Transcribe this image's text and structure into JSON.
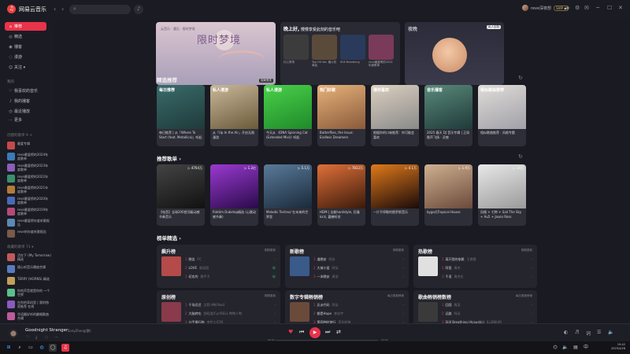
{
  "app": {
    "title": "网易云音乐",
    "logo_glyph": "♫"
  },
  "user": {
    "name": "reve深夜想",
    "vip": "SVIP ◆"
  },
  "sidebar": {
    "nav": [
      {
        "label": "推荐",
        "icon": "home-icon",
        "active": true
      },
      {
        "label": "精选",
        "icon": "compass-icon"
      },
      {
        "label": "播客",
        "icon": "podcast-icon"
      },
      {
        "label": "漫游",
        "icon": "roam-icon"
      },
      {
        "label": "关注 ▾",
        "icon": "follow-icon"
      }
    ],
    "mine_head": "我的",
    "mine": [
      {
        "label": "我喜欢的音乐",
        "icon": "heart-icon"
      },
      {
        "label": "我的播客",
        "icon": "mic-icon"
      },
      {
        "label": "最近播放",
        "icon": "clock-icon"
      },
      {
        "label": "更多",
        "icon": "more-icon"
      }
    ],
    "created_head": "创建的歌单 9  +",
    "created": [
      {
        "label": "最爱专辑",
        "color": "#c44a4a"
      },
      {
        "label": "reve最爱榜的2024年度歌单",
        "color": "#3a7bb8"
      },
      {
        "label": "reve最爱榜的2023年度歌单",
        "color": "#8a5fb5"
      },
      {
        "label": "reve最爱榜的2022年度歌单",
        "color": "#3b8f6e"
      },
      {
        "label": "reve最爱榜的2021年度歌单",
        "color": "#b57a3a"
      },
      {
        "label": "reve最爱榜的2020年度歌单",
        "color": "#4a6ab8"
      },
      {
        "label": "reve最爱榜的2019年度歌单",
        "color": "#b54a7a"
      },
      {
        "label": "reve最爱榜年度听歌报告",
        "color": "#5a8ab5"
      },
      {
        "label": "reve的年度听歌报告",
        "color": "#7a5a4a"
      }
    ],
    "collected_head": "收藏的歌单 71  ▾",
    "collected": [
      {
        "label": "活在下 (My Tomorrow) 精选",
        "color": "#c05a5a"
      },
      {
        "label": "随心听音乐播放合辑",
        "color": "#5a7ac0"
      },
      {
        "label": "TERRY (HORNS) 精选",
        "color": "#c0a05a"
      },
      {
        "label": "你的声音就是你的 一个世界",
        "color": "#5ac08a"
      },
      {
        "label": "在你的耳机里 | 我的独家推荐 在线",
        "color": "#8a5ac0"
      },
      {
        "label": "华语最好听的翻唱歌曲合辑",
        "color": "#c05a9a"
      }
    ]
  },
  "banners": {
    "dream": {
      "title": "限时梦境",
      "subtitle": "云音乐 · 遇见 · 限时梦境",
      "tag": "独家首发"
    },
    "tonight": {
      "title": "晚上好,",
      "subtitle": "慢慢享受此刻的音乐吧",
      "cards": [
        {
          "caption": "灯心秀场",
          "color": "#3c3c3c"
        },
        {
          "caption": "Top Hit Ver. 最火热单曲",
          "color": "#5a4a3a"
        },
        {
          "caption": "Still Breathing",
          "color": "#2a3a5a"
        },
        {
          "caption": "reve最爱榜的2024年度歌单",
          "color": "#7a3a5a"
        }
      ]
    },
    "night": {
      "title": "夜晚",
      "chip": "私人定制"
    }
  },
  "sections": {
    "selected": "精选推荐",
    "playlists": "推荐歌单 ›",
    "charts": "榜单精选 ›"
  },
  "selected_cards": [
    {
      "label": "每日推荐",
      "title": "每日推荐 | 从「Where To Start (feat. Metallica)」听起",
      "grad": "linear-gradient(160deg,#3a6b6b,#1f3a3a)"
    },
    {
      "label": "私人漫游",
      "title": "从「Up In the Air」开启无限漫游",
      "grad": "linear-gradient(160deg,#c9b79a,#6b5a3a)"
    },
    {
      "label": "私人漫游",
      "title": "今天从 《DNA Spinning Cat (Extended Mix)》听起",
      "grad": "linear-gradient(160deg,#4ad14a,#1f8a2a)"
    },
    {
      "label": "热门好歌",
      "title": "Butterflies, the Issue: Endless Dreamers",
      "grad": "linear-gradient(160deg,#e6b27a,#8a5a3a)"
    },
    {
      "label": "猜你喜欢",
      "title": "根据你的口味推荐：你可能会喜欢",
      "grad": "linear-gradient(160deg,#dcd0c0,#8a8a8a)"
    },
    {
      "label": "音乐播客",
      "title": "2025 春天 DJ 音乐专辑 | 正如歌声飞扬 · 灵感",
      "grad": "linear-gradient(160deg,#5a8a7a,#1f3a3a)"
    },
    {
      "label": "相似歌曲推荐",
      "title": "相似歌曲推荐 · 风格专题",
      "grad": "linear-gradient(160deg,#e0dcd8,#a0a0a8)"
    }
  ],
  "playlist_cards": [
    {
      "plays": "▷ 4764万",
      "title": "【电音】全球200首顶级动感节奏音乐",
      "grad": "linear-gradient(160deg,#444,#111)"
    },
    {
      "plays": "▷ 1.2亿",
      "title": "Riddim Dubstep精选 (心跳动感节奏)",
      "grad": "linear-gradient(160deg,#9a3ad1,#2a0a4a)"
    },
    {
      "plays": "▷ 5.1万",
      "title": "Melodic Techno/ 在未来的世界里",
      "grad": "linear-gradient(160deg,#5a7a9a,#1a2a3a)"
    },
    {
      "plays": "▷ 7812万",
      "title": "HDM | 全能hardstyle, 狂燥kick, 震撼听觉",
      "grad": "linear-gradient(160deg,#e0703a,#3a1a0a)"
    },
    {
      "plays": "▷ 4.1万",
      "title": "一片不停歇的俄罗斯音乐",
      "grad": "linear-gradient(160deg,#e07a1a,#1a0a0a)"
    },
    {
      "plays": "▷ 1.9万",
      "title": "kygo式Tropical House",
      "grad": "linear-gradient(160deg,#d0b090,#6a4a3a)"
    },
    {
      "plays": "▷ 10万",
      "title": "风格 + 七种 + Sail The Sky + Au5 + Jason Ross",
      "grad": "linear-gradient(160deg,#e8e8e8,#9a9a9a)"
    }
  ],
  "ranks": [
    {
      "title": "飙升榜",
      "update": "刚刚更新",
      "color": "#b54a4a",
      "rows": [
        {
          "n": "1",
          "song": "晚笑",
          "artist": "FC",
          "trend": "-"
        },
        {
          "n": "2",
          "song": "LOVE",
          "artist": "周深团",
          "trend": "新"
        },
        {
          "n": "3",
          "song": "初恋的",
          "artist": "歌手子",
          "trend": "新"
        }
      ]
    },
    {
      "title": "新歌榜",
      "update": "刚刚更新",
      "color": "#3a5a8a",
      "rows": [
        {
          "n": "1",
          "song": "道晚安",
          "artist": "阿朵",
          "trend": "-"
        },
        {
          "n": "2",
          "song": "大城小爱",
          "artist": "阿朵",
          "trend": "-"
        },
        {
          "n": "3",
          "song": "一米晚安",
          "artist": "周深",
          "trend": "-"
        }
      ]
    },
    {
      "title": "热歌榜",
      "update": "刚刚更新",
      "color": "#e0e0e0",
      "rows": [
        {
          "n": "1",
          "song": "离开我的依赖",
          "artist": "王艳薇",
          "trend": "-"
        },
        {
          "n": "2",
          "song": "阿瓷",
          "artist": "周杰",
          "trend": "-"
        },
        {
          "n": "3",
          "song": "千语",
          "artist": "周杰伦",
          "trend": "-"
        }
      ]
    },
    {
      "title": "原创榜",
      "update": "刚刚更新",
      "color": "#8a3a4a",
      "rows": [
        {
          "n": "1",
          "song": "千场迟迟",
          "artist": "艾莉·A鸭/YoxU",
          "trend": "-"
        },
        {
          "n": "2",
          "song": "大脑转吃",
          "artist": "舒昭游/Cyr/RELL·鸭鸭人鸭",
          "trend": "-"
        },
        {
          "n": "3",
          "song": "分手操行物",
          "artist": "李世人/CFA",
          "trend": "-"
        }
      ]
    },
    {
      "title": "数字专辑畅销榜",
      "update": "每日更新榜单",
      "color": "#6a4a3a",
      "rows": [
        {
          "n": "1",
          "song": "反派代码",
          "artist": "阿朵",
          "trend": "-"
        },
        {
          "n": "2",
          "song": "都是Hope",
          "artist": "李佳宇",
          "trend": "-"
        },
        {
          "n": "3",
          "song": "第四种时旅行",
          "artist": "音乐时旅",
          "trend": "-"
        }
      ]
    },
    {
      "title": "歌曲畅销榜数榜",
      "update": "每日更新榜单",
      "color": "#3a3a3a",
      "rows": [
        {
          "n": "1",
          "song": "回国",
          "artist": "周深",
          "trend": "-"
        },
        {
          "n": "2",
          "song": "远路",
          "artist": "阿朵",
          "trend": "-"
        },
        {
          "n": "3",
          "song": "Still Breathing (Acoustic)",
          "artist": "ILLENIUM",
          "trend": "-"
        }
      ]
    }
  ],
  "player": {
    "title": "Goodnight Stranger",
    "artist": "- SonyZhong(鹏)",
    "time_current": "00:00",
    "time_total": "04:03",
    "progress": 0.0
  },
  "taskbar": {
    "time": "19:42",
    "date": "2025/4/28"
  },
  "colors": {
    "accent": "#e8334a",
    "bg": "#1a1a22",
    "panel": "#25252e"
  }
}
